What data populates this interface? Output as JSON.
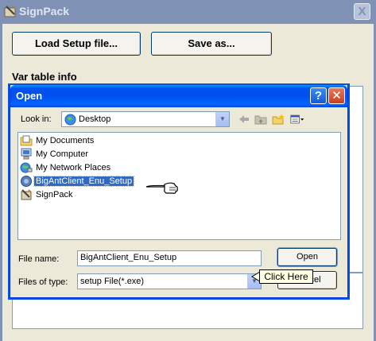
{
  "main_window": {
    "title": "SignPack",
    "close_glyph": "X",
    "load_button": "Load Setup file...",
    "save_button": "Save as...",
    "var_table_label": "Var table info"
  },
  "open_dialog": {
    "title": "Open",
    "help_glyph": "?",
    "close_glyph": "✕",
    "look_in_label": "Look in:",
    "look_in_value": "Desktop",
    "files": [
      {
        "label": "My Documents",
        "icon": "my-documents-icon",
        "selected": false
      },
      {
        "label": "My Computer",
        "icon": "my-computer-icon",
        "selected": false
      },
      {
        "label": "My Network Places",
        "icon": "network-places-icon",
        "selected": false
      },
      {
        "label": "BigAntClient_Enu_Setup",
        "icon": "setup-exe-icon",
        "selected": true
      },
      {
        "label": "SignPack",
        "icon": "signpack-app-icon",
        "selected": false
      }
    ],
    "file_name_label": "File name:",
    "file_name_value": "BigAntClient_Enu_Setup",
    "file_type_label": "Files of type:",
    "file_type_value": "setup File(*.exe)",
    "open_button": "Open",
    "cancel_button": "Cancel"
  },
  "tooltip": {
    "text": "Click Here"
  },
  "colors": {
    "xp_title_blue": "#0053ee",
    "inactive_title": "#7f92b5",
    "selection": "#316ac5",
    "tooltip_bg": "#ffffe1",
    "window_bg": "#ece9d8"
  }
}
